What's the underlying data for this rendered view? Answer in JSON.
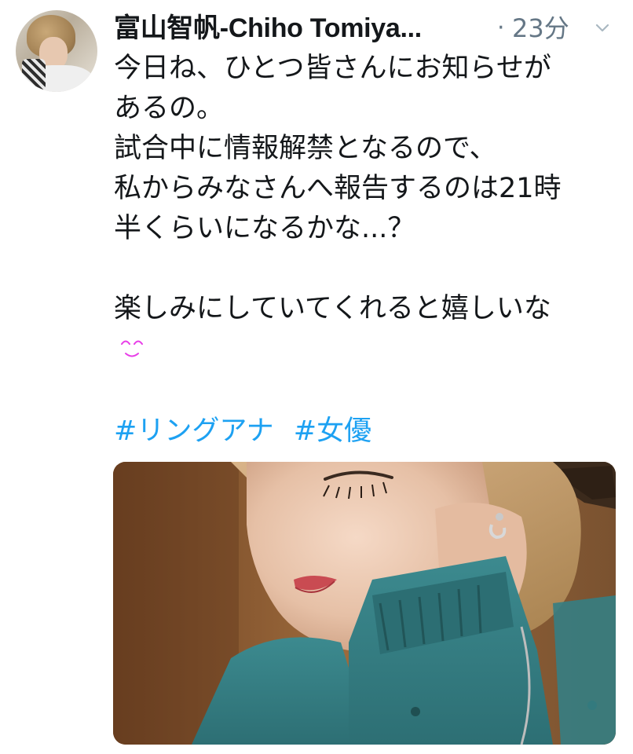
{
  "tweet": {
    "author_name": "富山智帆-Chiho Tomiya...",
    "separator": "·",
    "timestamp": "23分",
    "text_lines": [
      "今日ね、ひとつ皆さんにお知らせが",
      "あるの。",
      "試合中に情報解禁となるので、",
      "私からみなさんへ報告するのは21時",
      "半くらいになるかな...？",
      "",
      "楽しみにしていてくれると嬉しいな"
    ],
    "hashtags": [
      "#リングアナ",
      "#女優"
    ]
  },
  "icons": {
    "menu": "chevron-down-icon",
    "emoji": "smiling-eyes-emoji"
  },
  "colors": {
    "text": "#14171a",
    "muted": "#657786",
    "link": "#1da1f2",
    "emoji": "#e83ee8"
  }
}
